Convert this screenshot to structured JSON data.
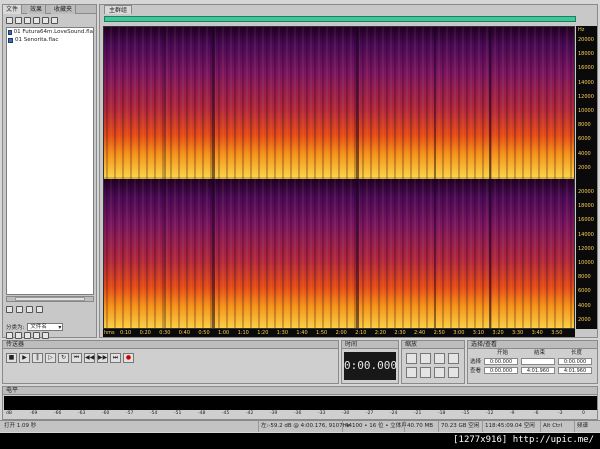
{
  "left_panel": {
    "tabs": [
      "文件",
      "效果",
      "收藏夹"
    ],
    "files": [
      "01 Futura64m.LoveSound.fla",
      "01 Senorita.flac"
    ],
    "sort_label": "分类为:",
    "sort_value": "文件名"
  },
  "main_panel": {
    "tab": "主群组",
    "time_unit": "hms",
    "freq_unit": "Hz",
    "time_ticks": [
      "0:10",
      "0:20",
      "0:30",
      "0:40",
      "0:50",
      "1:00",
      "1:10",
      "1:20",
      "1:30",
      "1:40",
      "1:50",
      "2:00",
      "2:10",
      "2:20",
      "2:30",
      "2:40",
      "2:50",
      "3:00",
      "3:10",
      "3:20",
      "3:30",
      "3:40",
      "3:50"
    ],
    "freq_ticks_ch1": [
      "20000",
      "18000",
      "16000",
      "14000",
      "12000",
      "10000",
      "8000",
      "6000",
      "4000",
      "2000"
    ],
    "freq_ticks_ch2": [
      "20000",
      "18000",
      "16000",
      "14000",
      "12000",
      "10000",
      "8000",
      "6000",
      "4000",
      "2000"
    ]
  },
  "transport": {
    "title": "传送器"
  },
  "time": {
    "title": "时间",
    "display": "0:00.000"
  },
  "zoom": {
    "title": "缩放"
  },
  "selection": {
    "title": "选择/查看",
    "headers": [
      "开始",
      "结束",
      "长度"
    ],
    "rows": [
      {
        "label": "选择",
        "start": "0:00.000",
        "end": "",
        "length": "0:00.000"
      },
      {
        "label": "查看",
        "start": "0:00.000",
        "end": "4:01.960",
        "length": "4:01.960"
      }
    ]
  },
  "level": {
    "title": "电平",
    "scale": [
      "dB",
      "-69",
      "-66",
      "-63",
      "-60",
      "-57",
      "-54",
      "-51",
      "-48",
      "-45",
      "-42",
      "-39",
      "-36",
      "-33",
      "-30",
      "-27",
      "-24",
      "-21",
      "-18",
      "-15",
      "-12",
      "-9",
      "-6",
      "-3",
      "0"
    ]
  },
  "status": {
    "open_info": "打开 1.09 秒",
    "cursor": "左:-59.2 dB @ 4:00.176, 9107Hz",
    "format": "44100 • 16 位 • 立体声",
    "size": "40.70 MB",
    "free": "70.23 GB 空闲",
    "time_free": "118:45:09.04 空闲",
    "key": "Alt Ctrl",
    "mode": "频谱"
  },
  "watermark": "[1277x916] http://upic.me/"
}
